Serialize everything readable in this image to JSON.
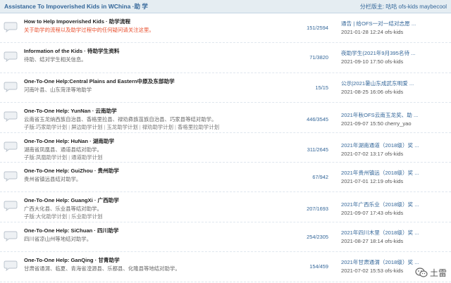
{
  "header": {
    "title": "Assistance To Impoverished Kids in WChina ·助 学",
    "moderators_label": "分栏版主:",
    "moderators": "咕咕 ofs-kids maybecool"
  },
  "forums": [
    {
      "title": "How to Help Impoverished Kids · 助学流程",
      "desc": "关于助学的流程以及助学过程中的任何疑问请关注这里。",
      "desc_red": true,
      "subforums": [],
      "count": "151/2594",
      "last_title": "通告 | 给OFS一对一结对志愿 ...",
      "last_meta": "2021-01-28 12:24 ofs-kids"
    },
    {
      "title": "Information of the Kids · 待助学生资料",
      "desc": "待助、结对学生相关信息。",
      "desc_red": false,
      "subforums": [],
      "count": "71/3820",
      "last_title": "夜助学生(2021年9月395名待 ...",
      "last_meta": "2021-09-10 17:50 ofs-kids"
    },
    {
      "title": "One-To-One Help:Central Plains and Eastern中原及东部助学",
      "desc": "河南叶县、山东菏泽等地助学",
      "desc_red": false,
      "subforums": [],
      "count": "15/15",
      "last_title": "公示|2021暑山东成武东明爱 ...",
      "last_meta": "2021-08-25 16:06 ofs-kids"
    },
    {
      "title": "One-To-One Help: YunNan · 云南助学",
      "desc": "云南省玉龙纳西族自治县、香格里拉县、禄劝彝族苗族自治县、巧家县等结对助学。",
      "desc_red": false,
      "subforums_label": "子版:",
      "subforums": [
        "巧家助学计划",
        "屏边助学计划",
        "玉龙助学计划",
        "禄劝助学计划",
        "香格里拉助学计划"
      ],
      "count": "446/3545",
      "last_title": "2021年秋OFS云南玉龙奖、助 ...",
      "last_meta": "2021-09-07 15:50 cherry_yao"
    },
    {
      "title": "One-To-One Help: HuNan · 湖南助学",
      "desc": "湖南省凤凰县、通道县结对助学。",
      "desc_red": false,
      "subforums_label": "子版:",
      "subforums": [
        "凤凰助学计划",
        "通道助学计划"
      ],
      "count": "311/2645",
      "last_title": "2021年湖南通道（2018级）奖 ...",
      "last_meta": "2021-07-02 13:17 ofs-kids"
    },
    {
      "title": "One-To-One Help: GuiZhou · 贵州助学",
      "desc": "贵州省镇远县结对助学。",
      "desc_red": false,
      "subforums": [],
      "count": "67/942",
      "last_title": "2021年贵州镇远（2018级）奖 ...",
      "last_meta": "2021-07-01 12:19 ofs-kids"
    },
    {
      "title": "One-To-One Help: GuangXi · 广西助学",
      "desc": "广西大化县、乐业县等结对助学。",
      "desc_red": false,
      "subforums_label": "子版:",
      "subforums": [
        "大化助学计划",
        "乐业助学计划"
      ],
      "count": "207/1693",
      "last_title": "2021年广西乐业（2018级）奖 ...",
      "last_meta": "2021-09-07 17:43 ofs-kids"
    },
    {
      "title": "One-To-One Help: SiChuan · 四川助学",
      "desc": "四川省凉山州等地结对助学。",
      "desc_red": false,
      "subforums": [],
      "count": "254/2305",
      "last_title": "2021年四川木里（2018级）奖 ...",
      "last_meta": "2021-08-27 18:14 ofs-kids"
    },
    {
      "title": "One-To-One Help: GanQing · 甘青助学",
      "desc": "甘肃省通渭、临夏、青海省湟源县、乐都县、化隆县等地结对助学。",
      "desc_red": false,
      "subforums": [],
      "count": "154/459",
      "last_title": "2021年甘肃通渭（2018级）奖 ...",
      "last_meta": "2021-07-02 15:53 ofs-kids"
    }
  ],
  "watermark": {
    "text": "土雷",
    "icon": "wechat-icon"
  },
  "colors": {
    "link": "#336699",
    "header_bg": "#e5edf2",
    "desc_red": "#e8502f"
  }
}
